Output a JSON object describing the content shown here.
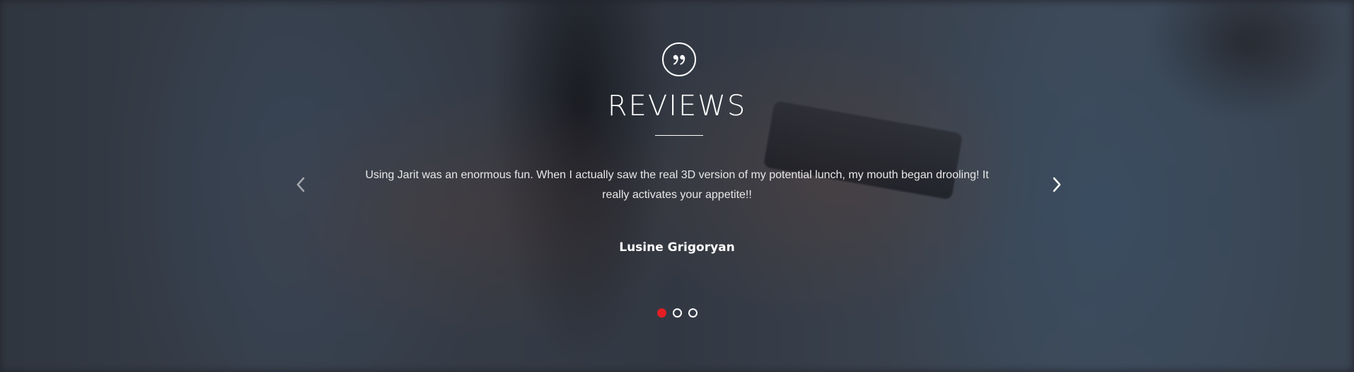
{
  "reviews": {
    "title": "REVIEWS",
    "icon": "quote-icon",
    "text": "Using Jarit was an enormous fun. When I actually saw the real 3D version of my potential lunch, my mouth began drooling! It really activates your appetite!!",
    "author": "Lusine Grigoryan",
    "prev_icon": "chevron-left-icon",
    "next_icon": "chevron-right-icon",
    "slides": {
      "count": 3,
      "active": 1
    },
    "colors": {
      "accent": "#e31e24",
      "text": "#ffffff",
      "overlay": "#1c1e26"
    }
  }
}
